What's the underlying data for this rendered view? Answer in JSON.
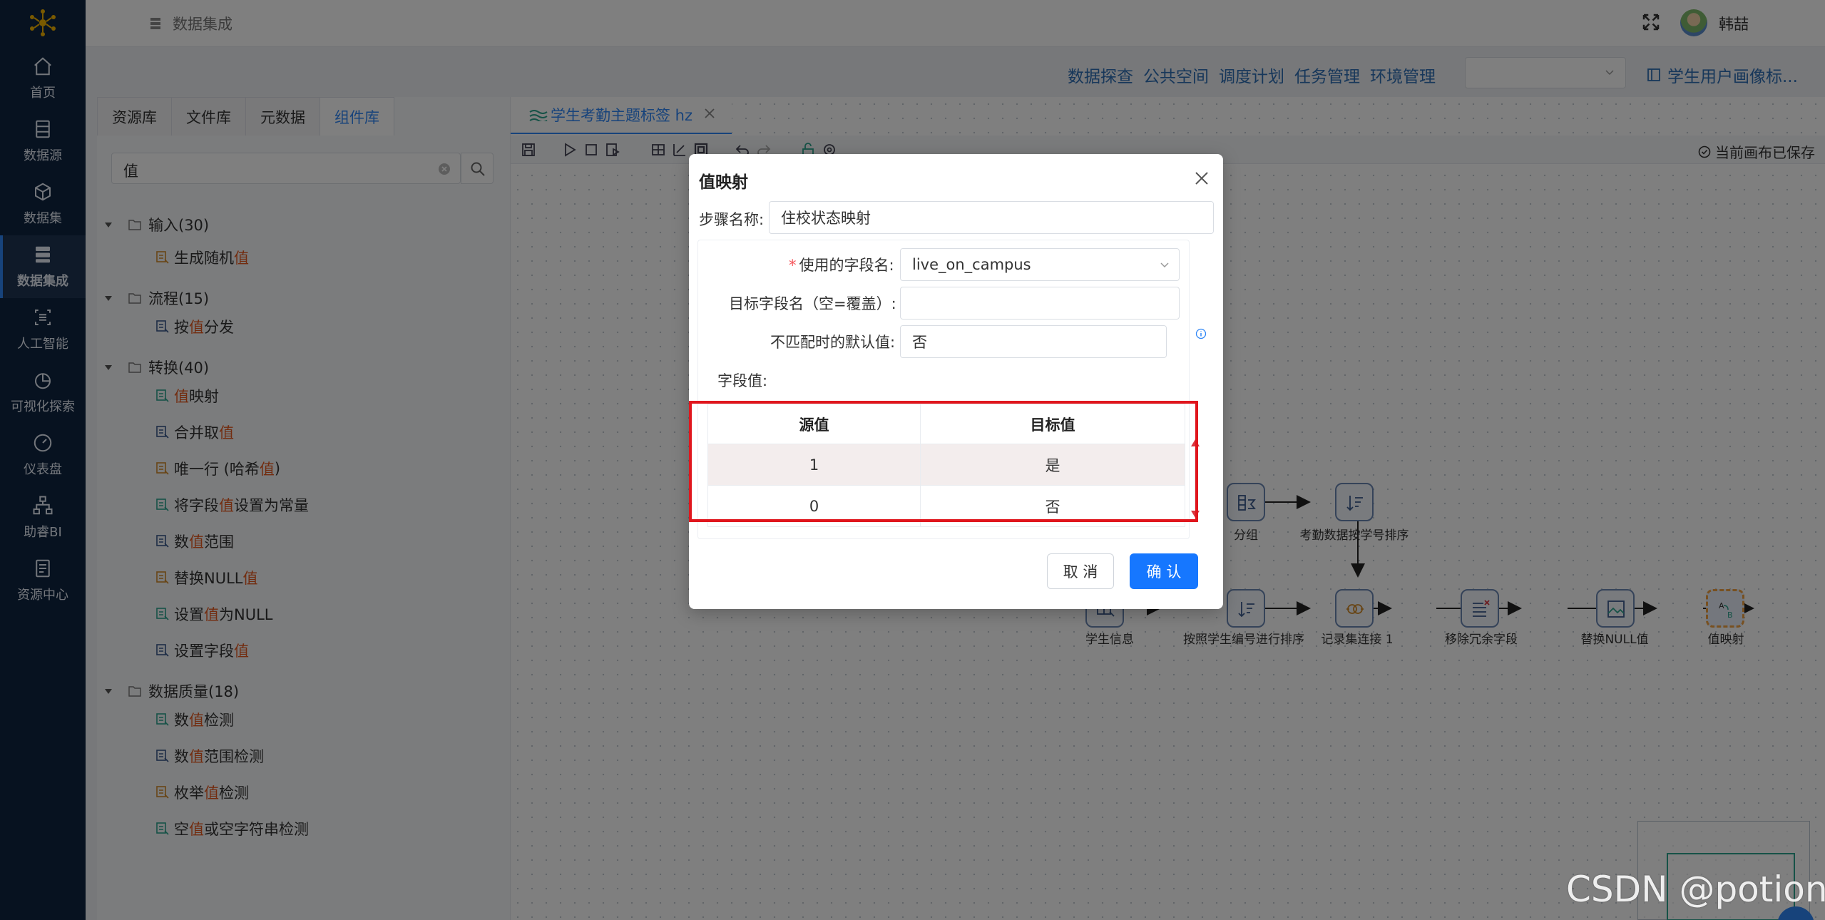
{
  "sidebar": {
    "items": [
      {
        "label": "首页",
        "icon": "home-icon"
      },
      {
        "label": "数据源",
        "icon": "database-icon"
      },
      {
        "label": "数据集",
        "icon": "cube-icon"
      },
      {
        "label": "数据集成",
        "icon": "server-icon",
        "active": true
      },
      {
        "label": "人工智能",
        "icon": "ai-icon"
      },
      {
        "label": "可视化探索",
        "icon": "pie-chart-icon"
      },
      {
        "label": "仪表盘",
        "icon": "gauge-icon"
      },
      {
        "label": "助睿BI",
        "icon": "org-chart-icon"
      },
      {
        "label": "资源中心",
        "icon": "folder-icon"
      }
    ]
  },
  "header": {
    "breadcrumb": "数据集成",
    "username": "韩喆"
  },
  "top_links": [
    "数据探查",
    "公共空间",
    "调度计划",
    "任务管理",
    "环境管理"
  ],
  "top_select": {
    "value": ""
  },
  "project_link": "学生用户画像标...",
  "panel": {
    "tabs": [
      "资源库",
      "文件库",
      "元数据",
      "组件库"
    ],
    "active_tab": "组件库",
    "search_value": "值",
    "tree": [
      {
        "type": "group",
        "label": "输入(30)"
      },
      {
        "type": "leaf",
        "before": "生成随机 ",
        "hl": "值",
        "after": ""
      },
      {
        "type": "group",
        "label": "流程(15)"
      },
      {
        "type": "leaf",
        "before": "按 ",
        "hl": "值",
        "after": " 分发"
      },
      {
        "type": "group",
        "label": "转换(40)"
      },
      {
        "type": "leaf",
        "before": "",
        "hl": "值",
        "after": " 映射"
      },
      {
        "type": "leaf",
        "before": "合并取 ",
        "hl": "值",
        "after": ""
      },
      {
        "type": "leaf",
        "before": "唯一行 (哈希 ",
        "hl": "值",
        "after": " )"
      },
      {
        "type": "leaf",
        "before": "将字段 ",
        "hl": "值",
        "after": " 设置为常量"
      },
      {
        "type": "leaf",
        "before": "数 ",
        "hl": "值",
        "after": " 范围"
      },
      {
        "type": "leaf",
        "before": "替换NULL ",
        "hl": "值",
        "after": ""
      },
      {
        "type": "leaf",
        "before": "设置 ",
        "hl": "值",
        "after": " 为NULL"
      },
      {
        "type": "leaf",
        "before": "设置字段 ",
        "hl": "值",
        "after": ""
      },
      {
        "type": "group",
        "label": "数据质量(18)"
      },
      {
        "type": "leaf",
        "before": "数 ",
        "hl": "值",
        "after": " 检测"
      },
      {
        "type": "leaf",
        "before": "数 ",
        "hl": "值",
        "after": " 范围检测"
      },
      {
        "type": "leaf",
        "before": "枚举 ",
        "hl": "值",
        "after": " 检测"
      },
      {
        "type": "leaf",
        "before": "空 ",
        "hl": "值",
        "after": " 或空字符串检测"
      }
    ]
  },
  "canvas": {
    "tab_title": "学生考勤主题标签 hz",
    "save_status": "当前画布已保存",
    "nodes": [
      "分组",
      "考勤数据按学号排序",
      "学生信息",
      "按照学生编号进行排序",
      "记录集连接 1",
      "移除冗余字段",
      "替换NULL值",
      "值映射"
    ]
  },
  "dialog": {
    "title": "值映射",
    "step_name_label": "步骤名称:",
    "step_name": "住校状态映射",
    "field_label": "使用的字段名:",
    "field_value": "live_on_campus",
    "target_label": "目标字段名（空=覆盖）:",
    "target_value": "",
    "default_label": "不匹配时的默认值:",
    "default_value": "否",
    "values_label": "字段值:",
    "table_headers": [
      "源值",
      "目标值"
    ],
    "rows": [
      {
        "source": "1",
        "target": "是"
      },
      {
        "source": "0",
        "target": "否"
      }
    ],
    "cancel": "取 消",
    "confirm": "确 认"
  },
  "watermark": "CSDN @potion()",
  "colors": {
    "sidebar_bg": "#0f2440",
    "accent": "#2f86f6",
    "primary_button": "#1677ff",
    "highlight": "#e5581f",
    "annotation_red": "#e0161d"
  }
}
